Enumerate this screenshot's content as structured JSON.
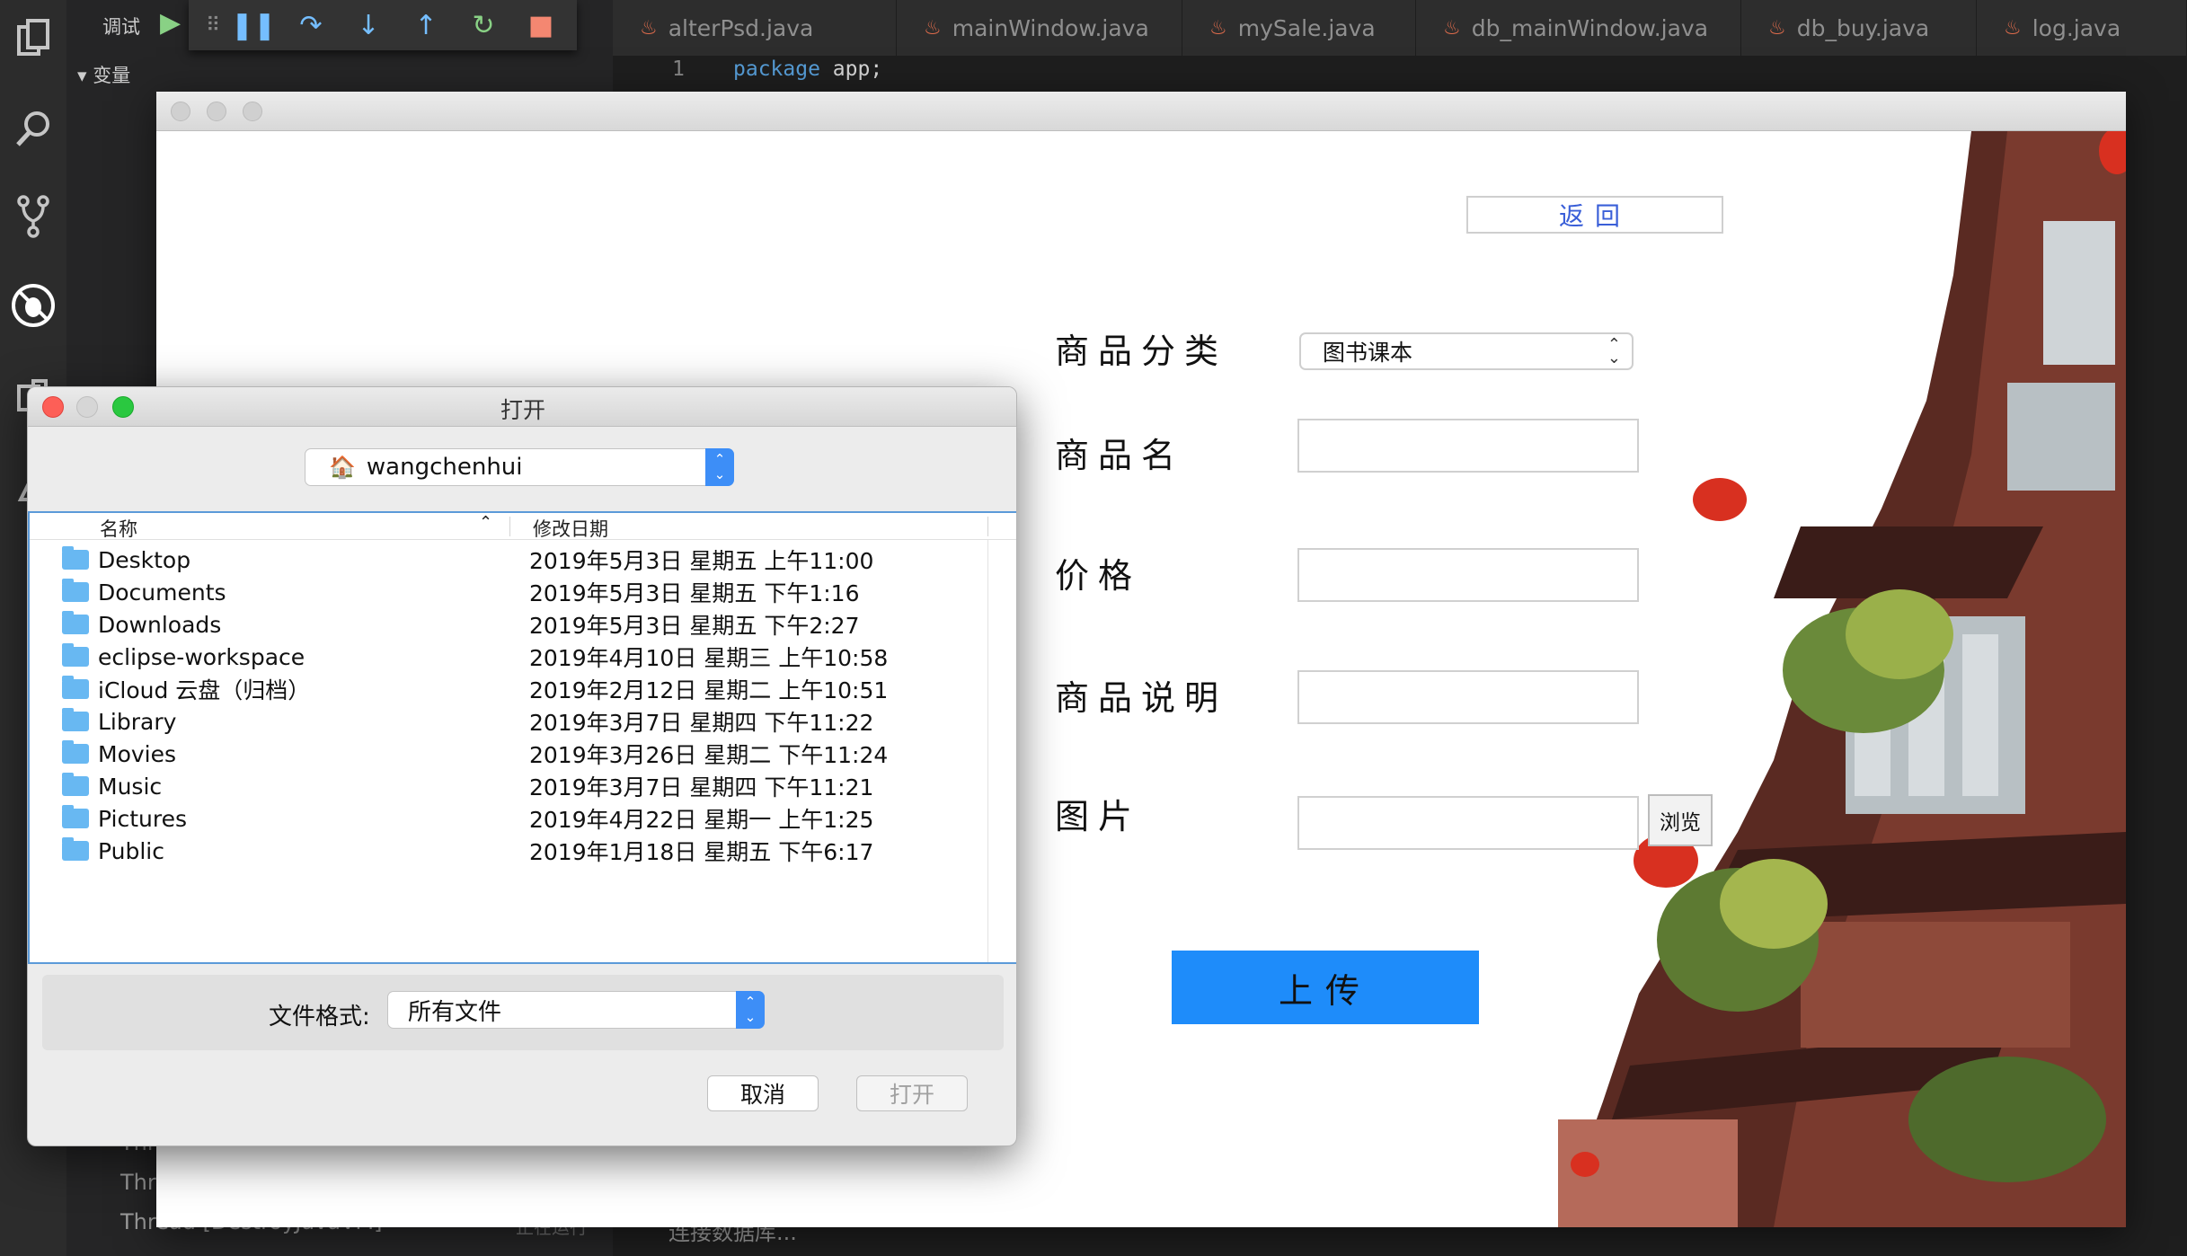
{
  "vscode": {
    "debug_label": "调试",
    "variables_header": "变量",
    "thread_lines": [
      "Thr",
      "Thr",
      "Thread [DestroyJavaVM]"
    ],
    "thread_status": "正在运行",
    "tabs": [
      "alterPsd.java",
      "mainWindow.java",
      "mySale.java",
      "db_mainWindow.java",
      "db_buy.java",
      "log.java"
    ],
    "line_number": "1",
    "code": {
      "keyword": "package",
      "rest": " app;"
    },
    "bottom_status": "连接数据库..."
  },
  "app": {
    "back_label": "返回",
    "category_label": "商品分类",
    "category_value": "图书课本",
    "name_label": "商品名",
    "price_label": "价格",
    "desc_label": "商品说明",
    "image_label": "图片",
    "browse_label": "浏览",
    "upload_label": "上传",
    "colors": {
      "upload_bg": "#1e8cfa",
      "back_text": "#3a5fd8"
    }
  },
  "dialog": {
    "title": "打开",
    "location": "wangchenhui",
    "columns": {
      "name": "名称",
      "date": "修改日期"
    },
    "files": [
      {
        "name": "Desktop",
        "date": "2019年5月3日 星期五 上午11:00"
      },
      {
        "name": "Documents",
        "date": "2019年5月3日 星期五 下午1:16"
      },
      {
        "name": "Downloads",
        "date": "2019年5月3日 星期五 下午2:27"
      },
      {
        "name": "eclipse-workspace",
        "date": "2019年4月10日 星期三 上午10:58"
      },
      {
        "name": "iCloud 云盘（归档）",
        "date": "2019年2月12日 星期二 上午10:51"
      },
      {
        "name": "Library",
        "date": "2019年3月7日 星期四 下午11:22"
      },
      {
        "name": "Movies",
        "date": "2019年3月26日 星期二 下午11:24"
      },
      {
        "name": "Music",
        "date": "2019年3月7日 星期四 下午11:21"
      },
      {
        "name": "Pictures",
        "date": "2019年4月22日 星期一 上午1:25"
      },
      {
        "name": "Public",
        "date": "2019年1月18日 星期五 下午6:17"
      }
    ],
    "format_label": "文件格式:",
    "format_value": "所有文件",
    "cancel_label": "取消",
    "open_label": "打开"
  }
}
